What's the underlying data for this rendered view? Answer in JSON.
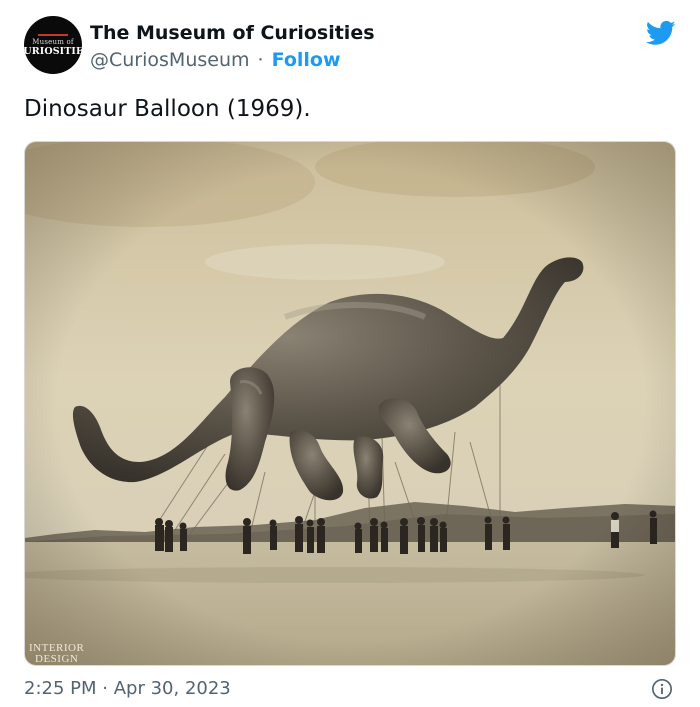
{
  "tweet": {
    "author": {
      "display_name": "The Museum of Curiosities",
      "handle": "@CuriosMuseum",
      "separator": "·",
      "follow_label": "Follow",
      "avatar": {
        "line1": "Museum of",
        "line2": "CURIOSITIES",
        "background": "#0a0a0a",
        "accent": "#c0392b"
      }
    },
    "platform_icon": "twitter-bird-icon",
    "text": "Dinosaur Balloon (1969).",
    "media": {
      "watermark_line1": "INTERIOR",
      "watermark_line2": "DESIGN"
    },
    "time": "2:25 PM",
    "date_separator": "·",
    "date": "Apr 30, 2023",
    "info_icon": "info-icon"
  },
  "colors": {
    "accent": "#1d9bf0",
    "text_primary": "#0f1419",
    "text_secondary": "#536471",
    "photo_sepia": "#cfc3a4"
  }
}
